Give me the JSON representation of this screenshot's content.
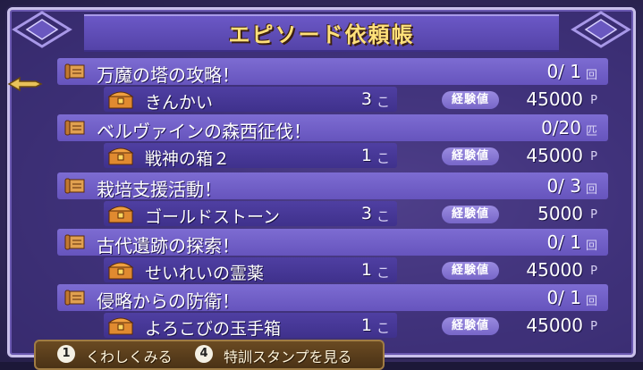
{
  "header": {
    "title": "エピソード依頼帳"
  },
  "labels": {
    "exp": "経験値",
    "exp_unit": "P"
  },
  "entries": [
    {
      "title": "万魔の塔の攻略！",
      "progress": "0/ 1",
      "unit": "回",
      "reward": "きんかい",
      "qty": "3",
      "qty_unit": "こ",
      "exp": "45000"
    },
    {
      "title": "ベルヴァインの森西征伐！",
      "progress": "0/20",
      "unit": "匹",
      "reward": "戦神の箱２",
      "qty": "1",
      "qty_unit": "こ",
      "exp": "45000"
    },
    {
      "title": "栽培支援活動！",
      "progress": "0/ 3",
      "unit": "回",
      "reward": "ゴールドストーン",
      "qty": "3",
      "qty_unit": "こ",
      "exp": "5000"
    },
    {
      "title": "古代遺跡の探索！",
      "progress": "0/ 1",
      "unit": "回",
      "reward": "せいれいの霊薬",
      "qty": "1",
      "qty_unit": "こ",
      "exp": "45000"
    },
    {
      "title": "侵略からの防衛！",
      "progress": "0/ 1",
      "unit": "回",
      "reward": "よろこびの玉手箱",
      "qty": "1",
      "qty_unit": "こ",
      "exp": "45000"
    }
  ],
  "footer": {
    "buttons": [
      {
        "key": "1",
        "label": "くわしくみる"
      },
      {
        "key": "4",
        "label": "特訓スタンプを見る"
      }
    ]
  },
  "colors": {
    "title": "#ffe07a",
    "quest_row": "#7361c8",
    "reward_row": "#4a3b9a",
    "panel_border": "#c9c0ea"
  }
}
